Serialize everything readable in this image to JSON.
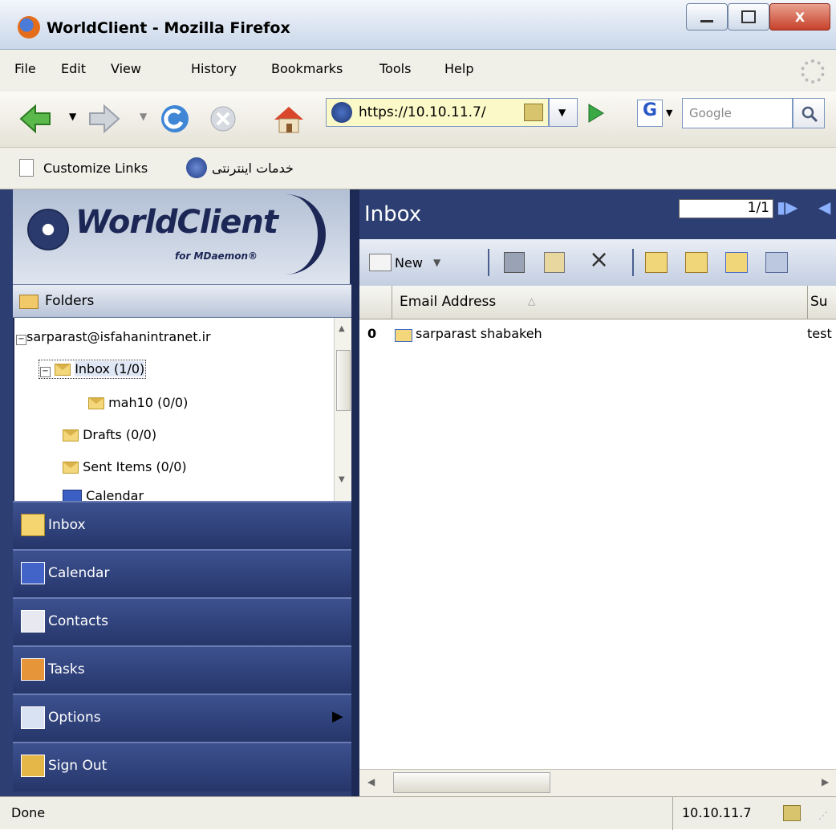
{
  "window": {
    "title": "WorldClient - Mozilla Firefox"
  },
  "menu": [
    "File",
    "Edit",
    "View",
    "History",
    "Bookmarks",
    "Tools",
    "Help"
  ],
  "address": {
    "url": "https://10.10.11.7/"
  },
  "search": {
    "placeholder": "Google"
  },
  "links": {
    "customize": "Customize Links",
    "persian": "خدمات اینترنتی"
  },
  "logo": {
    "name": "WorldClient",
    "sub": "for MDaemon®"
  },
  "folders": {
    "heading": "Folders",
    "account": "sarparast@isfahanintranet.ir",
    "items": [
      "Inbox (1/0)",
      "mah10 (0/0)",
      "Drafts (0/0)",
      "Sent Items (0/0)",
      "Calendar"
    ]
  },
  "nav": [
    "Inbox",
    "Calendar",
    "Contacts",
    "Tasks",
    "Options",
    "Sign Out"
  ],
  "main": {
    "title": "Inbox",
    "page": "1/1",
    "new_label": "New",
    "columns": {
      "email": "Email Address",
      "subject": "Su"
    },
    "messages": [
      {
        "from": "sarparast shabakeh",
        "subject": "test"
      }
    ]
  },
  "status": {
    "text": "Done",
    "host": "10.10.11.7"
  }
}
